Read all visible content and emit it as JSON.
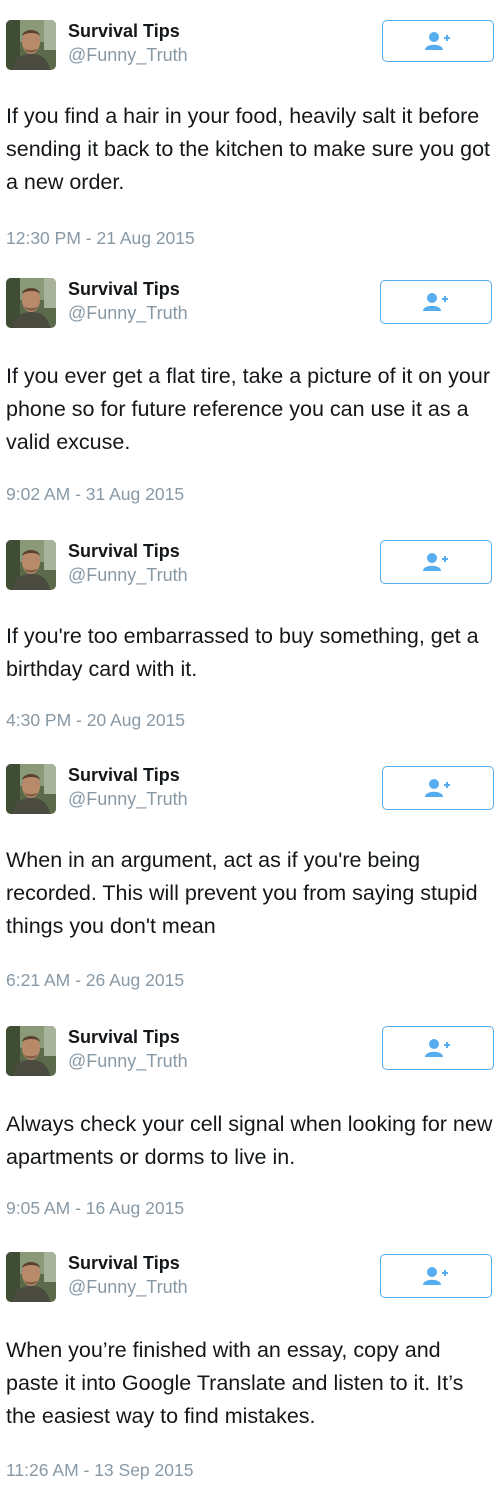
{
  "tweets": [
    {
      "name": "Survival Tips",
      "handle": "@Funny_Truth",
      "text": "If you find a hair in your food, heavily salt it before sending it back to the kitchen to make sure you got a new order.",
      "timestamp": "12:30 PM - 21 Aug 2015",
      "follow_icon": "person-add-icon"
    },
    {
      "name": "Survival Tips",
      "handle": "@Funny_Truth",
      "text": "If you ever get a flat tire, take a picture of it on your phone so for future reference you can use it as a valid excuse.",
      "timestamp": "9:02 AM - 31 Aug 2015",
      "follow_icon": "person-add-icon"
    },
    {
      "name": "Survival Tips",
      "handle": "@Funny_Truth",
      "text": "If you're too embarrassed to buy something, get a birthday card with it.",
      "timestamp": "4:30 PM - 20 Aug 2015",
      "follow_icon": "person-add-icon"
    },
    {
      "name": "Survival Tips",
      "handle": "@Funny_Truth",
      "text": "When in an argument, act as if you're being recorded. This will prevent you from saying stupid things you don't mean",
      "timestamp": "6:21 AM - 26 Aug 2015",
      "follow_icon": "person-add-icon"
    },
    {
      "name": "Survival Tips",
      "handle": "@Funny_Truth",
      "text": "Always check your cell signal when looking for new apartments or dorms to live in.",
      "timestamp": "9:05 AM - 16 Aug 2015",
      "follow_icon": "person-add-icon"
    },
    {
      "name": "Survival Tips",
      "handle": "@Funny_Truth",
      "text": "When you’re finished with an essay, copy and paste it into Google Translate and listen to it. It’s the easiest way to find mistakes.",
      "timestamp": "11:26 AM - 13 Sep 2015",
      "follow_icon": "person-add-icon"
    }
  ],
  "colors": {
    "accent": "#55acee",
    "secondary_text": "#8899a6",
    "primary_text": "#14171a"
  }
}
